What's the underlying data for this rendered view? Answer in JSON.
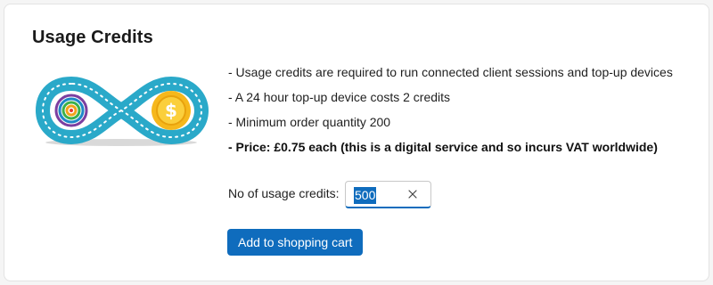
{
  "card": {
    "title": "Usage Credits"
  },
  "logo": {
    "icon": "infinity-coin-logo",
    "coin_symbol": "$",
    "colors": {
      "loop": "#2aa9c9",
      "loop_dark": "#1b8fae",
      "coin": "#f6b81c",
      "coin_inner": "#fbcf3c"
    }
  },
  "description": {
    "items": [
      {
        "text": "- Usage credits are required to run connected client sessions and top-up devices",
        "bold": false
      },
      {
        "text": "- A 24 hour top-up device costs 2 credits",
        "bold": false
      },
      {
        "text": "- Minimum order quantity 200",
        "bold": false
      },
      {
        "text": "- Price: £0.75 each (this is a digital service and so incurs VAT worldwide)",
        "bold": true
      }
    ]
  },
  "quantity": {
    "label": "No of usage credits:",
    "value": "500",
    "clear_icon": "close-icon"
  },
  "actions": {
    "add_to_cart_label": "Add to shopping cart"
  },
  "theme": {
    "accent": "#0f6cbd"
  }
}
